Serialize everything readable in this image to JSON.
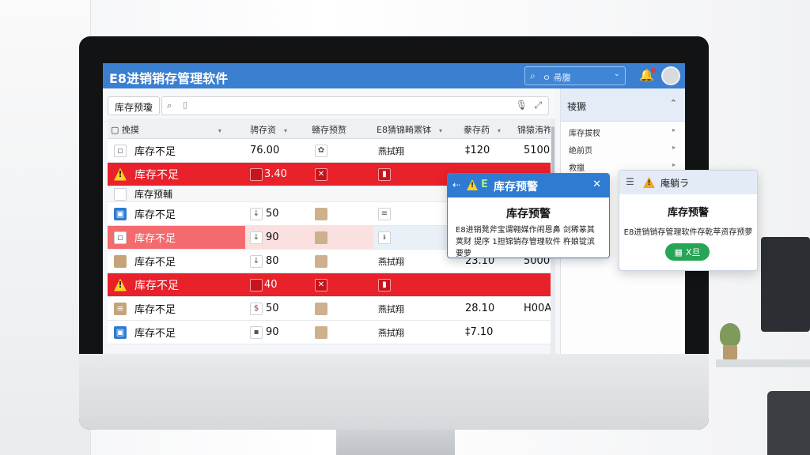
{
  "app": {
    "title": "E8进销销存管理软件"
  },
  "header": {
    "search_placeholder": "ㅇ 帚腹"
  },
  "toolbar": {
    "tab_label": "库存预瓊"
  },
  "table": {
    "headers": [
      "挽摸",
      "骋存资",
      "赣存预赘",
      "E8猜锦畸罴钵",
      "豢存药",
      "锦猿洧祚"
    ],
    "sub_row_label": "库存预輔",
    "rows": [
      {
        "status": "库存不足",
        "qty": "76.00",
        "c3": "",
        "c4": "燕拭翔",
        "c5": "‡120",
        "c6": "5100",
        "style": "normal",
        "icon": "box"
      },
      {
        "status": "库存不足",
        "qty": "3.40",
        "c3": "",
        "c4": "",
        "c5": "",
        "c6": "",
        "style": "alert",
        "icon": "warn"
      },
      {
        "status": "库存不足",
        "qty": "50",
        "c3": "",
        "c4": "",
        "c5": "",
        "c6": "",
        "style": "normal",
        "icon": "blue"
      },
      {
        "status": "库存不足",
        "qty": "90",
        "c3": "",
        "c4": "",
        "c5": "",
        "c6": "",
        "style": "pink",
        "icon": "box"
      },
      {
        "status": "库存不足",
        "qty": "80",
        "c3": "",
        "c4": "燕拭翔",
        "c5": "23.10",
        "c6": "5000",
        "style": "normal",
        "icon": "tan"
      },
      {
        "status": "库存不足",
        "qty": "40",
        "c3": "",
        "c4": "",
        "c5": "",
        "c6": "",
        "style": "alert",
        "icon": "warn"
      },
      {
        "status": "库存不足",
        "qty": "50",
        "c3": "",
        "c4": "燕拭翔",
        "c5": "28.10",
        "c6": "H00A",
        "style": "normal",
        "icon": "tan"
      },
      {
        "status": "库存不足",
        "qty": "90",
        "c3": "",
        "c4": "燕拭翔",
        "c5": "‡7.10",
        "c6": "",
        "style": "normal",
        "icon": "blue"
      }
    ]
  },
  "right_panel": {
    "title": "祾獗",
    "items": [
      "库存拔杈",
      "绝前页",
      "救擸"
    ]
  },
  "dialog_main": {
    "header": "库存预警",
    "letter": "E",
    "title": "库存预警",
    "message": "E8进销凳斧宝谓翱媒作闹恩鼻  剑稀篆其荚财 提序  1担锦销存管理软件  杵娘锭滨要萝"
  },
  "dialog_side": {
    "header": "庵躺ラ",
    "title": "库存预警",
    "message": "E8进销销存管理软件存乾苹资存预萝",
    "button": "X旦"
  },
  "colors": {
    "accent": "#3a7fd0",
    "alert_row": "#e8212a",
    "confirm_button": "#27a455"
  }
}
